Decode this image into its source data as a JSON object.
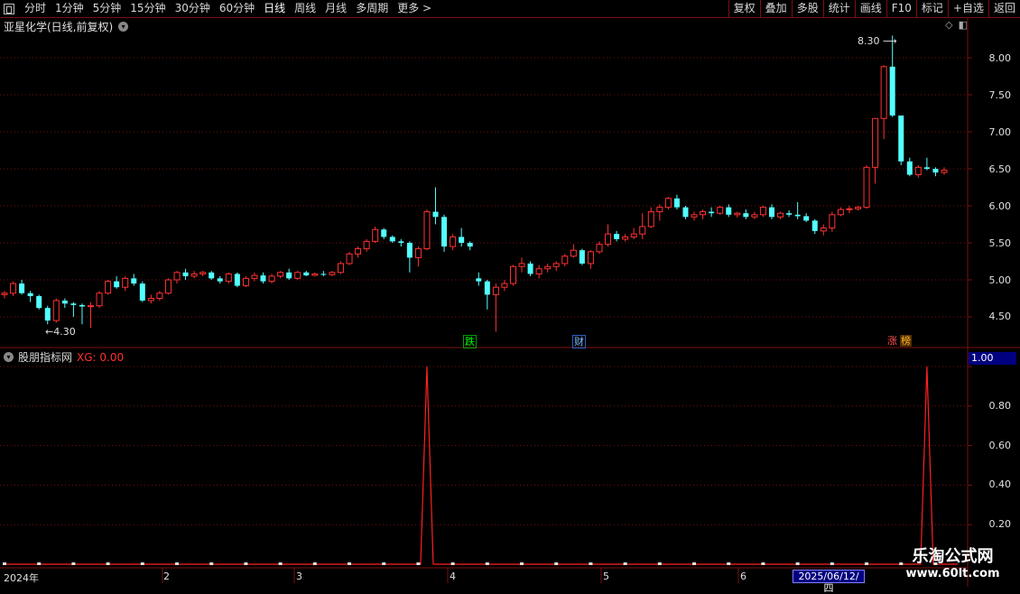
{
  "toolbar": {
    "periods": [
      "分时",
      "1分钟",
      "5分钟",
      "15分钟",
      "30分钟",
      "60分钟",
      "日线",
      "周线",
      "月线",
      "多周期",
      "更多 >"
    ],
    "active_period": "日线",
    "actions": [
      "复权",
      "叠加",
      "多股",
      "统计",
      "画线",
      "F10",
      "+自选",
      "返回"
    ],
    "mark_label": "标记"
  },
  "stock": {
    "title": "亚星化学(日线,前复权)"
  },
  "price_axis": {
    "labels": [
      "8.00",
      "7.50",
      "7.00",
      "6.50",
      "6.00",
      "5.50",
      "5.00",
      "4.50"
    ]
  },
  "annotations": {
    "high": "8.30",
    "low": "4.30"
  },
  "markers": {
    "die": "跌",
    "cai": "财",
    "zhang": "涨",
    "bang": "榜"
  },
  "indicator": {
    "name": "股朋指标网",
    "value_text": "XG: 0.00",
    "current": "1.00",
    "axis_labels": [
      "1.00",
      "0.80",
      "0.60",
      "0.40",
      "0.20"
    ]
  },
  "dates": {
    "year": "2024年",
    "months": [
      "2",
      "3",
      "4",
      "5",
      "6"
    ],
    "cursor": "2025/06/12/四"
  },
  "watermark": {
    "line1": "乐淘公式网",
    "line2": "www.60lt.com"
  },
  "colors": {
    "up": "#ff3232",
    "down": "#54ffff",
    "grid": "#7a1010",
    "signal": "#ff2020"
  },
  "chart_data": {
    "type": "candlestick",
    "title": "亚星化学(日线,前复权)",
    "ylim": [
      4.2,
      8.4
    ],
    "candles": [
      [
        4.8,
        4.85,
        4.75,
        4.82
      ],
      [
        4.82,
        4.98,
        4.78,
        4.95
      ],
      [
        4.95,
        5.0,
        4.8,
        4.82
      ],
      [
        4.82,
        4.85,
        4.7,
        4.78
      ],
      [
        4.78,
        4.8,
        4.6,
        4.62
      ],
      [
        4.62,
        4.65,
        4.4,
        4.45
      ],
      [
        4.45,
        4.75,
        4.42,
        4.72
      ],
      [
        4.72,
        4.75,
        4.62,
        4.68
      ],
      [
        4.68,
        4.7,
        4.5,
        4.66
      ],
      [
        4.66,
        4.68,
        4.4,
        4.64
      ],
      [
        4.64,
        4.7,
        4.35,
        4.65
      ],
      [
        4.65,
        4.85,
        4.62,
        4.82
      ],
      [
        4.82,
        5.0,
        4.8,
        4.98
      ],
      [
        4.98,
        5.05,
        4.88,
        4.9
      ],
      [
        4.9,
        5.05,
        4.85,
        5.02
      ],
      [
        5.02,
        5.08,
        4.92,
        4.95
      ],
      [
        4.95,
        4.98,
        4.7,
        4.72
      ],
      [
        4.72,
        4.8,
        4.68,
        4.75
      ],
      [
        4.75,
        4.85,
        4.72,
        4.82
      ],
      [
        4.82,
        5.02,
        4.8,
        5.0
      ],
      [
        5.0,
        5.12,
        4.95,
        5.1
      ],
      [
        5.1,
        5.15,
        5.0,
        5.05
      ],
      [
        5.05,
        5.12,
        5.02,
        5.08
      ],
      [
        5.08,
        5.12,
        5.05,
        5.1
      ],
      [
        5.1,
        5.12,
        5.0,
        5.02
      ],
      [
        5.02,
        5.05,
        4.95,
        4.98
      ],
      [
        4.98,
        5.1,
        4.95,
        5.08
      ],
      [
        5.08,
        5.1,
        4.9,
        4.92
      ],
      [
        4.92,
        5.05,
        4.9,
        5.02
      ],
      [
        5.02,
        5.1,
        4.98,
        5.06
      ],
      [
        5.06,
        5.1,
        4.95,
        4.98
      ],
      [
        4.98,
        5.08,
        4.95,
        5.05
      ],
      [
        5.05,
        5.12,
        5.02,
        5.1
      ],
      [
        5.1,
        5.15,
        5.0,
        5.02
      ],
      [
        5.02,
        5.12,
        5.0,
        5.1
      ],
      [
        5.1,
        5.12,
        5.05,
        5.06
      ],
      [
        5.06,
        5.1,
        5.05,
        5.08
      ],
      [
        5.08,
        5.12,
        5.05,
        5.07
      ],
      [
        5.07,
        5.12,
        5.05,
        5.1
      ],
      [
        5.1,
        5.25,
        5.08,
        5.22
      ],
      [
        5.22,
        5.38,
        5.2,
        5.35
      ],
      [
        5.35,
        5.45,
        5.3,
        5.42
      ],
      [
        5.42,
        5.55,
        5.38,
        5.52
      ],
      [
        5.52,
        5.72,
        5.5,
        5.68
      ],
      [
        5.68,
        5.7,
        5.55,
        5.58
      ],
      [
        5.58,
        5.6,
        5.5,
        5.52
      ],
      [
        5.52,
        5.55,
        5.45,
        5.5
      ],
      [
        5.5,
        5.52,
        5.1,
        5.3
      ],
      [
        5.3,
        5.45,
        5.18,
        5.42
      ],
      [
        5.42,
        5.95,
        5.4,
        5.92
      ],
      [
        5.92,
        6.25,
        5.75,
        5.85
      ],
      [
        5.85,
        5.88,
        5.38,
        5.45
      ],
      [
        5.45,
        5.62,
        5.4,
        5.58
      ],
      [
        5.58,
        5.7,
        5.45,
        5.5
      ],
      [
        5.5,
        5.52,
        5.4,
        5.45
      ],
      [
        5.02,
        5.1,
        4.92,
        4.98
      ],
      [
        4.98,
        5.0,
        4.6,
        4.8
      ],
      [
        4.8,
        4.95,
        4.3,
        4.9
      ],
      [
        4.9,
        5.0,
        4.85,
        4.95
      ],
      [
        4.95,
        5.2,
        4.92,
        5.18
      ],
      [
        5.18,
        5.3,
        5.1,
        5.22
      ],
      [
        5.22,
        5.25,
        5.05,
        5.08
      ],
      [
        5.08,
        5.2,
        5.02,
        5.15
      ],
      [
        5.15,
        5.22,
        5.1,
        5.18
      ],
      [
        5.18,
        5.25,
        5.12,
        5.22
      ],
      [
        5.22,
        5.35,
        5.18,
        5.32
      ],
      [
        5.32,
        5.48,
        5.3,
        5.4
      ],
      [
        5.4,
        5.42,
        5.2,
        5.22
      ],
      [
        5.22,
        5.4,
        5.15,
        5.38
      ],
      [
        5.38,
        5.52,
        5.35,
        5.48
      ],
      [
        5.48,
        5.75,
        5.45,
        5.62
      ],
      [
        5.62,
        5.66,
        5.52,
        5.55
      ],
      [
        5.55,
        5.62,
        5.52,
        5.58
      ],
      [
        5.58,
        5.7,
        5.55,
        5.62
      ],
      [
        5.62,
        5.9,
        5.55,
        5.72
      ],
      [
        5.72,
        5.98,
        5.7,
        5.92
      ],
      [
        5.92,
        6.02,
        5.8,
        5.98
      ],
      [
        5.98,
        6.12,
        5.95,
        6.1
      ],
      [
        6.1,
        6.15,
        5.95,
        5.98
      ],
      [
        5.98,
        6.0,
        5.82,
        5.85
      ],
      [
        5.85,
        5.92,
        5.8,
        5.88
      ],
      [
        5.88,
        5.95,
        5.82,
        5.92
      ],
      [
        5.92,
        5.98,
        5.85,
        5.9
      ],
      [
        5.9,
        6.0,
        5.88,
        5.98
      ],
      [
        5.98,
        6.02,
        5.85,
        5.88
      ],
      [
        5.88,
        5.92,
        5.84,
        5.9
      ],
      [
        5.9,
        5.95,
        5.82,
        5.85
      ],
      [
        5.85,
        5.92,
        5.82,
        5.88
      ],
      [
        5.88,
        6.0,
        5.85,
        5.98
      ],
      [
        5.98,
        6.02,
        5.82,
        5.85
      ],
      [
        5.85,
        5.92,
        5.82,
        5.9
      ],
      [
        5.9,
        5.94,
        5.85,
        5.88
      ],
      [
        5.88,
        6.05,
        5.82,
        5.86
      ],
      [
        5.86,
        5.9,
        5.78,
        5.8
      ],
      [
        5.8,
        5.82,
        5.62,
        5.66
      ],
      [
        5.66,
        5.75,
        5.6,
        5.7
      ],
      [
        5.7,
        5.92,
        5.65,
        5.88
      ],
      [
        5.88,
        5.98,
        5.86,
        5.95
      ],
      [
        5.95,
        6.0,
        5.9,
        5.96
      ],
      [
        5.96,
        6.0,
        5.94,
        5.98
      ],
      [
        5.98,
        6.55,
        5.96,
        6.52
      ],
      [
        6.52,
        7.18,
        6.3,
        7.18
      ],
      [
        7.18,
        7.9,
        6.9,
        7.88
      ],
      [
        7.88,
        8.3,
        7.2,
        7.22
      ],
      [
        7.22,
        7.15,
        6.55,
        6.6
      ],
      [
        6.6,
        6.65,
        6.4,
        6.42
      ],
      [
        6.42,
        6.55,
        6.38,
        6.52
      ],
      [
        6.52,
        6.65,
        6.48,
        6.5
      ],
      [
        6.5,
        6.52,
        6.4,
        6.45
      ],
      [
        6.45,
        6.52,
        6.42,
        6.48
      ]
    ],
    "indicator_series": {
      "name": "XG",
      "spikes_at_candle": [
        49,
        107
      ],
      "values_range": [
        0,
        1
      ]
    }
  }
}
